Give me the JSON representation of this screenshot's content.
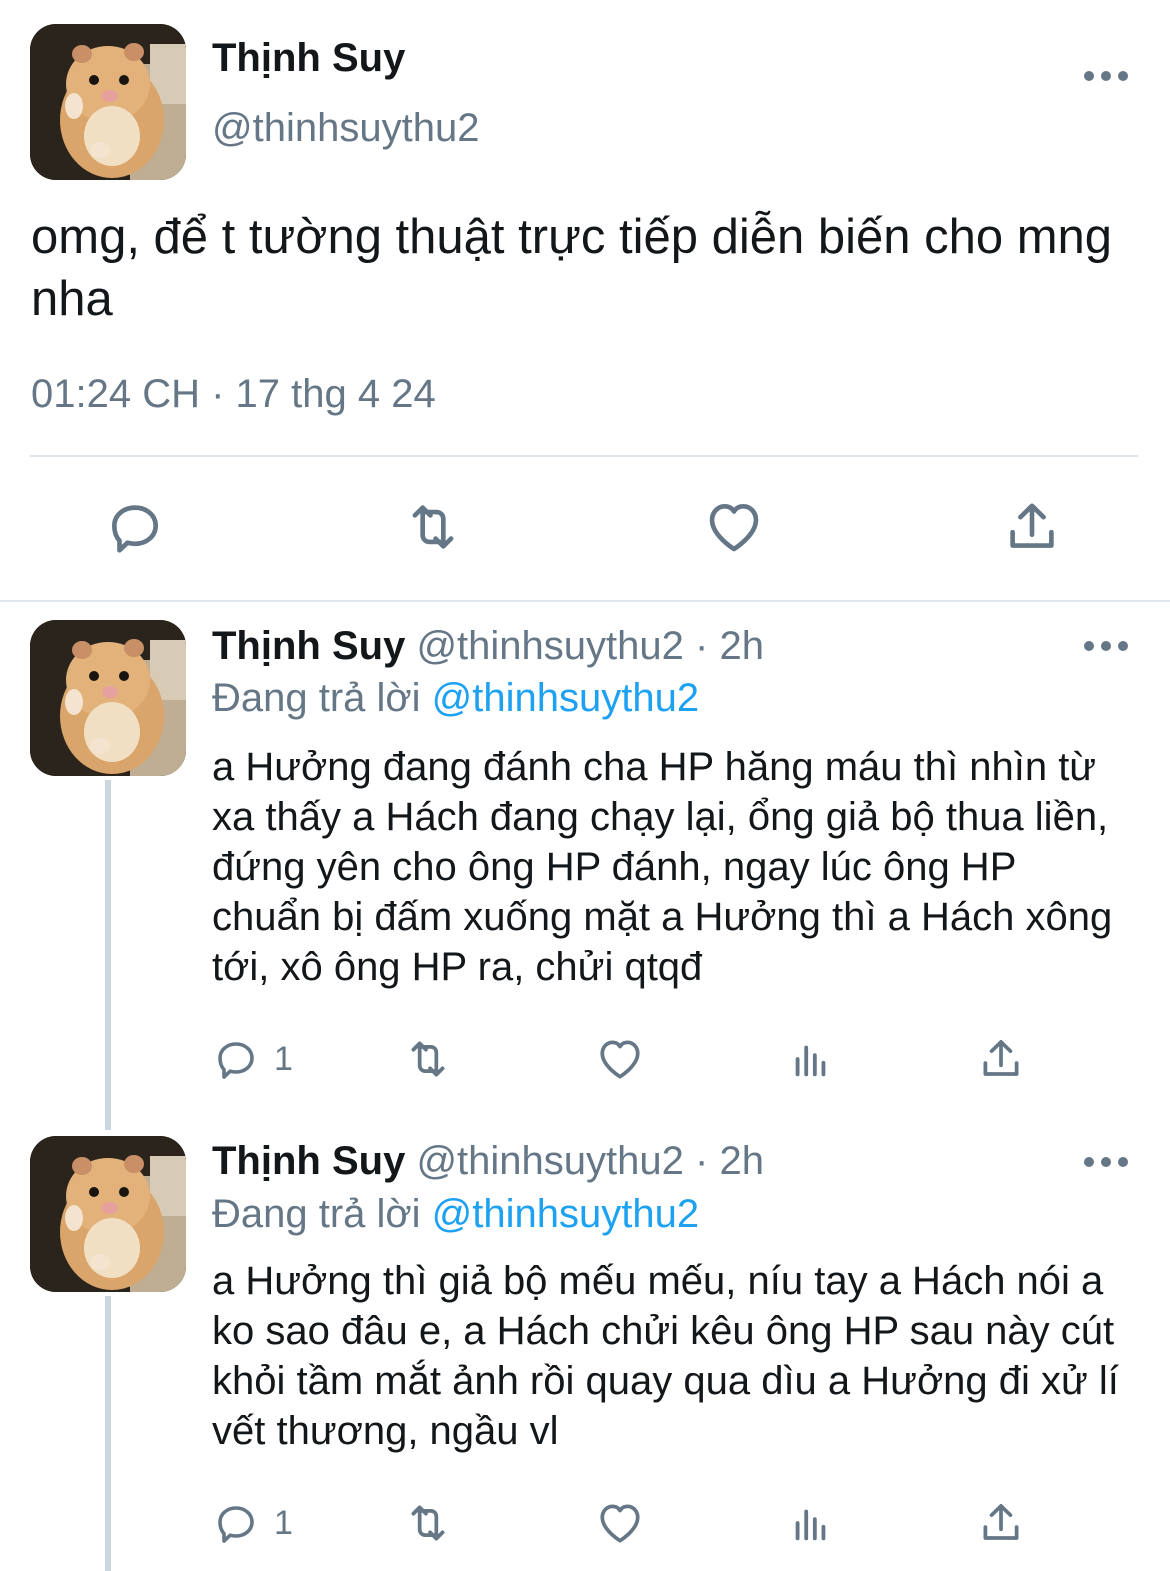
{
  "main_tweet": {
    "author_name": "Thịnh Suy",
    "handle": "@thinhsuythu2",
    "text": "omg, để t tường thuật trực tiếp diễn biến cho mng nha",
    "timestamp": "01:24 CH · 17 thg 4 24",
    "actions": [
      "reply-icon",
      "retweet-icon",
      "like-icon",
      "share-icon"
    ]
  },
  "replies": [
    {
      "author_name": "Thịnh Suy",
      "handle": "@thinhsuythu2",
      "separator": "·",
      "time": "2h",
      "replying_label": "Đang trả lời",
      "replying_to": "@thinhsuythu2",
      "text": "a Hưởng đang đánh cha HP hăng máu thì nhìn từ xa thấy a Hách đang chạy lại, ổng giả bộ thua liền, đứng yên cho ông HP đánh, ngay lúc ông HP chuẩn bị đấm xuống mặt a Hưởng thì a Hách xông tới, xô ông HP ra, chửi qtqđ",
      "reply_count": "1"
    },
    {
      "author_name": "Thịnh Suy",
      "handle": "@thinhsuythu2",
      "separator": "·",
      "time": "2h",
      "replying_label": "Đang trả lời",
      "replying_to": "@thinhsuythu2",
      "text": "a Hưởng thì giả bộ mếu mếu, níu tay a Hách nói a ko sao đâu e, a Hách chửi kêu ông HP sau này cút khỏi tầm mắt ảnh rồi quay qua dìu a Hưởng đi xử lí vết thương, ngầu vl",
      "reply_count": "1"
    }
  ],
  "colors": {
    "text": "#14171a",
    "secondary": "#657786",
    "link": "#1da1f2",
    "divider": "#e1e8ed",
    "thread_line": "#ccd6dd"
  }
}
